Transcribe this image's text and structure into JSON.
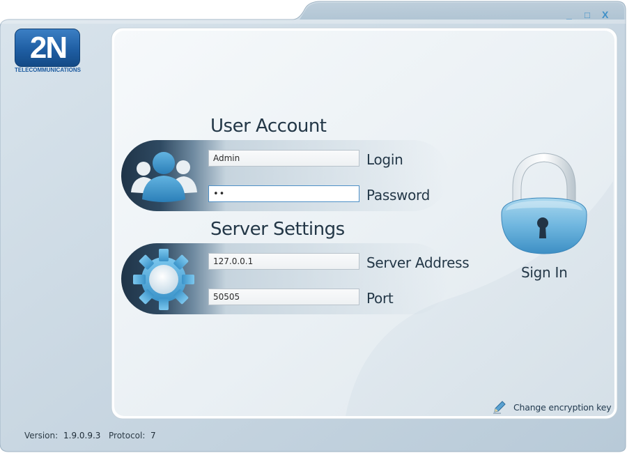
{
  "window": {
    "minimize_glyph": "_",
    "maximize_glyph": "□",
    "close_glyph": "X"
  },
  "logo": {
    "text": "2N",
    "subtitle": "TELECOMMUNICATIONS"
  },
  "user_account": {
    "title": "User Account",
    "icon": "users-icon",
    "login": {
      "label": "Login",
      "value": "Admin"
    },
    "password": {
      "label": "Password",
      "value": "••"
    }
  },
  "server_settings": {
    "title": "Server Settings",
    "icon": "gear-icon",
    "address": {
      "label": "Server Address",
      "value": "127.0.0.1"
    },
    "port": {
      "label": "Port",
      "value": "50505"
    }
  },
  "sign_in": {
    "label": "Sign In",
    "icon": "padlock-icon"
  },
  "encryption": {
    "label": "Change encryption key",
    "icon": "pencil-icon"
  },
  "status_bar": {
    "version_label": "Version:",
    "version_value": "1.9.0.9.3",
    "protocol_label": "Protocol:",
    "protocol_value": "7"
  },
  "colors": {
    "accent": "#3f90c8",
    "text": "#233747",
    "band_dark": "#1f3448"
  }
}
